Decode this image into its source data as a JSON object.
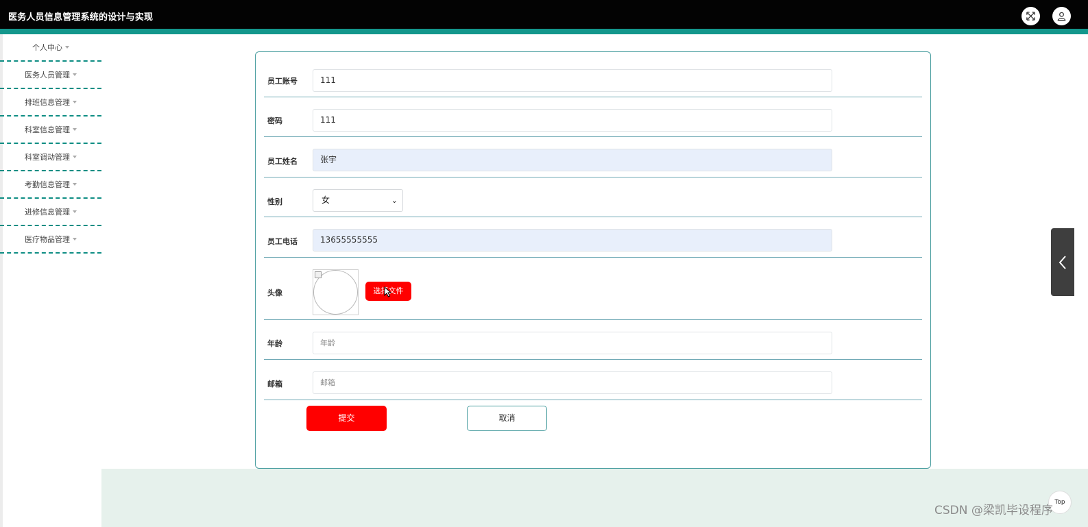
{
  "app": {
    "title": "医务人员信息管理系统的设计与实现"
  },
  "sidebar": {
    "items": [
      {
        "label": "个人中心"
      },
      {
        "label": "医务人员管理"
      },
      {
        "label": "排班信息管理"
      },
      {
        "label": "科室信息管理"
      },
      {
        "label": "科室调动管理"
      },
      {
        "label": "考勤信息管理"
      },
      {
        "label": "进修信息管理"
      },
      {
        "label": "医疗物品管理"
      }
    ]
  },
  "form": {
    "account": {
      "label": "员工账号",
      "value": "111"
    },
    "password": {
      "label": "密码",
      "value": "111"
    },
    "name": {
      "label": "员工姓名",
      "value": "张宇"
    },
    "gender": {
      "label": "性别",
      "value": "女"
    },
    "phone": {
      "label": "员工电话",
      "value": "13655555555"
    },
    "avatar": {
      "label": "头像",
      "choose_label": "选择文件"
    },
    "age": {
      "label": "年龄",
      "value": "",
      "placeholder": "年龄"
    },
    "email": {
      "label": "邮箱",
      "value": "",
      "placeholder": "邮箱"
    },
    "submit_label": "提交",
    "cancel_label": "取消"
  },
  "floating": {
    "top_label": "Top"
  },
  "watermark": "CSDN @梁凯毕设程序",
  "colors": {
    "topbar": "#030303",
    "accent": "#13978c",
    "primary_button": "#ff0000",
    "panel_border": "#4a9ea0",
    "footer_band": "#e6f1ec"
  },
  "icons": {
    "fullscreen": "fullscreen-icon",
    "user": "user-icon",
    "collapse": "chevron-left-icon"
  }
}
